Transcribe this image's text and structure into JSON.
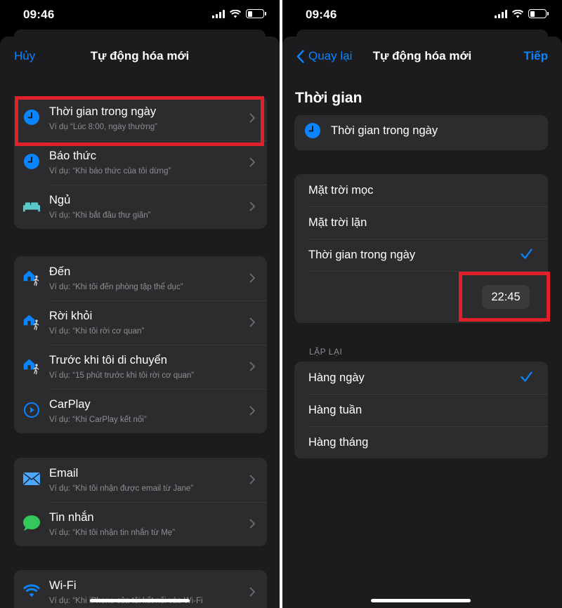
{
  "status_bar": {
    "time": "09:46"
  },
  "left": {
    "nav": {
      "cancel": "Hủy",
      "title": "Tự động hóa mới"
    },
    "groups": [
      [
        {
          "icon": "clock-icon",
          "title": "Thời gian trong ngày",
          "subtitle": "Ví dụ “Lúc 8:00, ngày thường”"
        },
        {
          "icon": "clock-icon",
          "title": "Báo thức",
          "subtitle": "Ví dụ: “Khi báo thức của tôi dừng”"
        },
        {
          "icon": "bed-icon",
          "title": "Ngủ",
          "subtitle": "Ví dụ: “Khi bắt đầu thư giãn”"
        }
      ],
      [
        {
          "icon": "home-walk-icon",
          "title": "Đến",
          "subtitle": "Ví dụ: “Khi tôi đến phòng tập thể dục”"
        },
        {
          "icon": "home-walk-icon",
          "title": "Rời khỏi",
          "subtitle": "Ví dụ: “Khi tôi rời cơ quan”"
        },
        {
          "icon": "home-walk-icon",
          "title": "Trước khi tôi di chuyển",
          "subtitle": "Ví dụ: “15 phút trước khi tôi rời cơ quan”"
        },
        {
          "icon": "carplay-icon",
          "title": "CarPlay",
          "subtitle": "Ví dụ: “Khi CarPlay kết nối”"
        }
      ],
      [
        {
          "icon": "mail-icon",
          "title": "Email",
          "subtitle": "Ví dụ: “Khi tôi nhận được email từ Jane”"
        },
        {
          "icon": "message-icon",
          "title": "Tin nhắn",
          "subtitle": "Ví dụ: “Khi tôi nhận tin nhắn từ Mẹ”"
        }
      ],
      [
        {
          "icon": "wifi-icon",
          "title": "Wi-Fi",
          "subtitle": "Ví dụ: “Khi iPhone của tôi kết nối vào Wi-Fi"
        }
      ]
    ]
  },
  "right": {
    "nav": {
      "back": "Quay lại",
      "title": "Tự động hóa mới",
      "next": "Tiếp"
    },
    "section_title": "Thời gian",
    "selected_trigger": "Thời gian trong ngày",
    "time_options": [
      {
        "label": "Mặt trời mọc",
        "checked": false
      },
      {
        "label": "Mặt trời lặn",
        "checked": false
      },
      {
        "label": "Thời gian trong ngày",
        "checked": true
      }
    ],
    "time_value": "22:45",
    "repeat_caption": "LẶP LẠI",
    "repeat_options": [
      {
        "label": "Hàng ngày",
        "checked": true
      },
      {
        "label": "Hàng tuần",
        "checked": false
      },
      {
        "label": "Hàng tháng",
        "checked": false
      }
    ]
  },
  "colors": {
    "accent": "#0a84ff",
    "highlight": "#e0202a",
    "background": "#1c1c1e",
    "cell": "#2c2c2e"
  }
}
